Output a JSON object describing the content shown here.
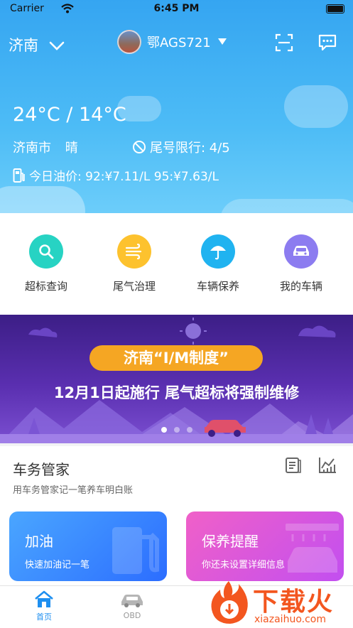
{
  "status_bar": {
    "carrier": "Carrier",
    "time": "6:45 PM"
  },
  "header": {
    "city": "济南",
    "plate": "鄂AGS721",
    "scan_icon": "scan-icon",
    "message_icon": "message-icon"
  },
  "weather": {
    "temperature": "24°C / 14°C",
    "city_name": "济南市",
    "condition": "晴",
    "restriction": "尾号限行: 4/5",
    "oil_price": "今日油价: 92:¥7.11/L  95:¥7.63/L"
  },
  "quick_actions": [
    {
      "label": "超标查询",
      "icon": "search-icon",
      "color": "#27d3c3"
    },
    {
      "label": "尾气治理",
      "icon": "exhaust-icon",
      "color": "#fdc22e"
    },
    {
      "label": "车辆保养",
      "icon": "umbrella-icon",
      "color": "#20b3f0"
    },
    {
      "label": "我的车辆",
      "icon": "car-icon",
      "color": "#8c7cf0"
    }
  ],
  "banner": {
    "tag": "济南“I/M制度”",
    "headline": "12月1日起施行  尾气超标将强制维修",
    "active_slide": 1,
    "total_slides": 3
  },
  "car_manager": {
    "title": "车务管家",
    "subtitle": "用车务管家记一笔养车明白账",
    "cards": [
      {
        "title": "加油",
        "subtitle": "快速加油记一笔",
        "icon": "fuel-pump-icon"
      },
      {
        "title": "保养提醒",
        "subtitle": "你还未设置详细信息",
        "icon": "car-wash-icon"
      }
    ]
  },
  "tabbar": {
    "tabs": [
      {
        "label": "首页",
        "active": true
      },
      {
        "label": "OBD",
        "active": false
      }
    ]
  },
  "watermark": {
    "title": "下载火",
    "url": "xiazaihuo.com"
  },
  "colors": {
    "accent": "#1e8ff0",
    "hero_top": "#35a5f1",
    "banner": "#4b26a0",
    "pill": "#f5a623"
  }
}
